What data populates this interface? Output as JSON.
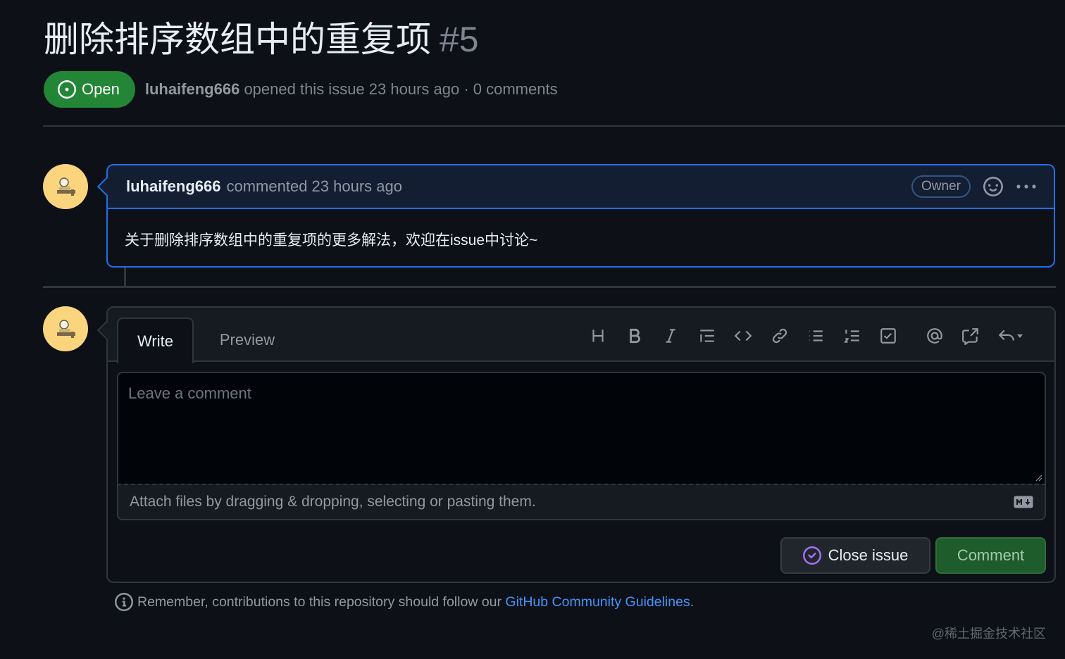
{
  "issue": {
    "title": "删除排序数组中的重复项",
    "number": "#5",
    "state": "Open",
    "author": "luhaifeng666",
    "meta": "opened this issue 23 hours ago · 0 comments"
  },
  "comment": {
    "author": "luhaifeng666",
    "when": "commented 23 hours ago",
    "role_badge": "Owner",
    "body": "关于删除排序数组中的重复项的更多解法，欢迎在issue中讨论~",
    "header_icons": [
      "smiley-icon",
      "kebab-menu-icon"
    ]
  },
  "editor": {
    "tabs": [
      "Write",
      "Preview"
    ],
    "toolbar": [
      "heading",
      "bold",
      "italic",
      "quote",
      "code",
      "link",
      "unordered-list",
      "ordered-list",
      "task-list",
      "mention",
      "cross-reference",
      "saved-replies"
    ],
    "placeholder": "Leave a comment",
    "attach_text": "Attach files by dragging & dropping, selecting or pasting them.",
    "close_label": "Close issue",
    "comment_label": "Comment"
  },
  "footer": {
    "guidelines_prefix": "Remember, contributions to this repository should follow our ",
    "guidelines_link": "GitHub Community Guidelines",
    "guidelines_suffix": "."
  },
  "watermark": "@稀土掘金技术社区",
  "colors": {
    "background": "#0d1117",
    "open_green": "#238636",
    "link_blue": "#4493f8",
    "owner_border": "#1f6feb",
    "close_icon_purple": "#a371f7"
  }
}
